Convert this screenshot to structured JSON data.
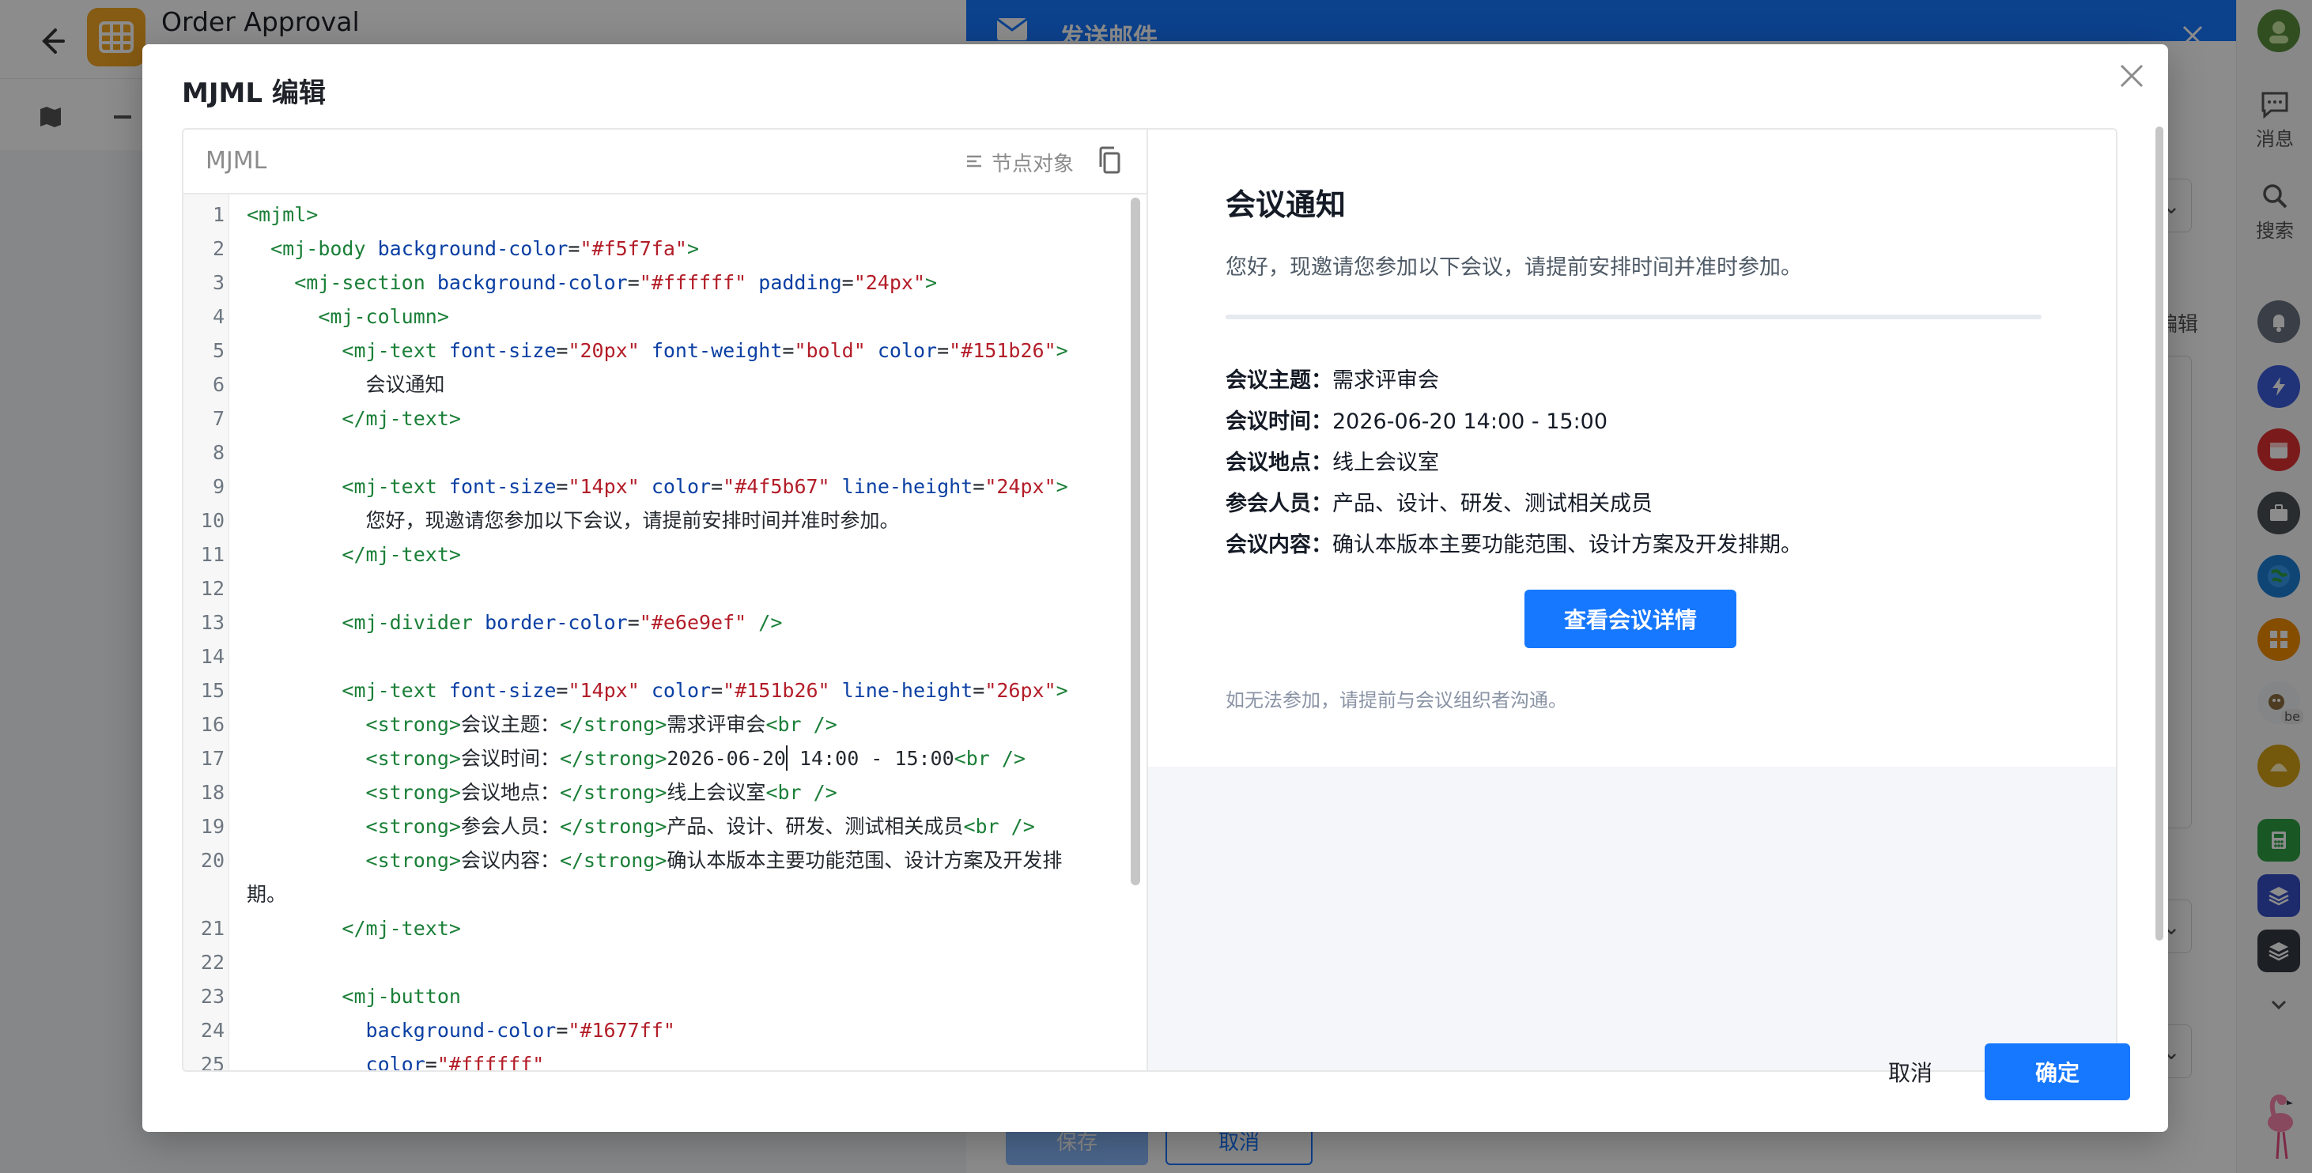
{
  "background": {
    "app_title": "Order Approval",
    "mail_panel_title": "发送邮件",
    "save_label": "保存",
    "cancel_label": "取消",
    "side_edit_label": "编辑",
    "side_btn_glyph": "⌄"
  },
  "rail": {
    "messages_label": "消息",
    "search_label": "搜索",
    "avatar_badge": "be"
  },
  "modal": {
    "title": "MJML 编辑",
    "editor": {
      "language": "MJML",
      "node_object_label": "节点对象"
    },
    "code_lines": [
      {
        "n": "1",
        "html": "<span class='tag'>&lt;mjml&gt;</span>"
      },
      {
        "n": "2",
        "html": "  <span class='tag'>&lt;mj-body</span> <span class='attr'>background-color</span>=<span class='str'>\"#f5f7fa\"</span><span class='tag'>&gt;</span>"
      },
      {
        "n": "3",
        "html": "    <span class='tag'>&lt;mj-section</span> <span class='attr'>background-color</span>=<span class='str'>\"#ffffff\"</span> <span class='attr'>padding</span>=<span class='str'>\"24px\"</span><span class='tag'>&gt;</span>"
      },
      {
        "n": "4",
        "html": "      <span class='tag'>&lt;mj-column&gt;</span>"
      },
      {
        "n": "5",
        "html": "        <span class='tag'>&lt;mj-text</span> <span class='attr'>font-size</span>=<span class='str'>\"20px\"</span> <span class='attr'>font-weight</span>=<span class='str'>\"bold\"</span> <span class='attr'>color</span>=<span class='str'>\"#151b26\"</span><span class='tag'>&gt;</span>"
      },
      {
        "n": "6",
        "html": "          <span class='txt'>会议通知</span>"
      },
      {
        "n": "7",
        "html": "        <span class='tag'>&lt;/mj-text&gt;</span>"
      },
      {
        "n": "8",
        "html": ""
      },
      {
        "n": "9",
        "html": "        <span class='tag'>&lt;mj-text</span> <span class='attr'>font-size</span>=<span class='str'>\"14px\"</span> <span class='attr'>color</span>=<span class='str'>\"#4f5b67\"</span> <span class='attr'>line-height</span>=<span class='str'>\"24px\"</span><span class='tag'>&gt;</span>"
      },
      {
        "n": "10",
        "html": "          <span class='txt'>您好，现邀请您参加以下会议，请提前安排时间并准时参加。</span>"
      },
      {
        "n": "11",
        "html": "        <span class='tag'>&lt;/mj-text&gt;</span>"
      },
      {
        "n": "12",
        "html": ""
      },
      {
        "n": "13",
        "html": "        <span class='tag'>&lt;mj-divider</span> <span class='attr'>border-color</span>=<span class='str'>\"#e6e9ef\"</span> <span class='tag'>/&gt;</span>"
      },
      {
        "n": "14",
        "html": ""
      },
      {
        "n": "15",
        "html": "        <span class='tag'>&lt;mj-text</span> <span class='attr'>font-size</span>=<span class='str'>\"14px\"</span> <span class='attr'>color</span>=<span class='str'>\"#151b26\"</span> <span class='attr'>line-height</span>=<span class='str'>\"26px\"</span><span class='tag'>&gt;</span>"
      },
      {
        "n": "16",
        "html": "          <span class='tag'>&lt;strong&gt;</span><span class='txt'>会议主题：</span><span class='tag'>&lt;/strong&gt;</span><span class='txt'>需求评审会</span><span class='tag'>&lt;br /&gt;</span>"
      },
      {
        "n": "17",
        "html": "          <span class='tag'>&lt;strong&gt;</span><span class='txt'>会议时间：</span><span class='tag'>&lt;/strong&gt;</span><span class='txt'>2026-06-20<span class='caret'></span> 14:00 - 15:00</span><span class='tag'>&lt;br /&gt;</span>"
      },
      {
        "n": "18",
        "html": "          <span class='tag'>&lt;strong&gt;</span><span class='txt'>会议地点：</span><span class='tag'>&lt;/strong&gt;</span><span class='txt'>线上会议室</span><span class='tag'>&lt;br /&gt;</span>"
      },
      {
        "n": "19",
        "html": "          <span class='tag'>&lt;strong&gt;</span><span class='txt'>参会人员：</span><span class='tag'>&lt;/strong&gt;</span><span class='txt'>产品、设计、研发、测试相关成员</span><span class='tag'>&lt;br /&gt;</span>"
      },
      {
        "n": "20",
        "html": "          <span class='tag'>&lt;strong&gt;</span><span class='txt'>会议内容：</span><span class='tag'>&lt;/strong&gt;</span><span class='txt'>确认本版本主要功能范围、设计方案及开发排</span>"
      },
      {
        "n": "",
        "html": "<span class='txt'>期。</span>"
      },
      {
        "n": "21",
        "html": "        <span class='tag'>&lt;/mj-text&gt;</span>"
      },
      {
        "n": "22",
        "html": ""
      },
      {
        "n": "23",
        "html": "        <span class='tag'>&lt;mj-button</span>"
      },
      {
        "n": "24",
        "html": "          <span class='attr'>background-color</span>=<span class='str'>\"#1677ff\"</span>"
      },
      {
        "n": "25",
        "html": "          <span class='attr'>color</span>=<span class='str'>\"#ffffff\"</span>"
      }
    ],
    "preview": {
      "title": "会议通知",
      "intro": "您好，现邀请您参加以下会议，请提前安排时间并准时参加。",
      "details": [
        {
          "label": "会议主题：",
          "value": "需求评审会"
        },
        {
          "label": "会议时间：",
          "value": "2026-06-20 14:00 - 15:00"
        },
        {
          "label": "会议地点：",
          "value": "线上会议室"
        },
        {
          "label": "参会人员：",
          "value": "产品、设计、研发、测试相关成员"
        },
        {
          "label": "会议内容：",
          "value": "确认本版本主要功能范围、设计方案及开发排期。"
        }
      ],
      "button_label": "查看会议详情",
      "note": "如无法参加，请提前与会议组织者沟通。"
    },
    "footer": {
      "cancel_label": "取消",
      "ok_label": "确定"
    }
  },
  "colors": {
    "primary": "#1677ff",
    "title_text": "#151b26",
    "body_text": "#4f5b67",
    "divider": "#e6e9ef",
    "preview_bg": "#f5f7fa"
  }
}
